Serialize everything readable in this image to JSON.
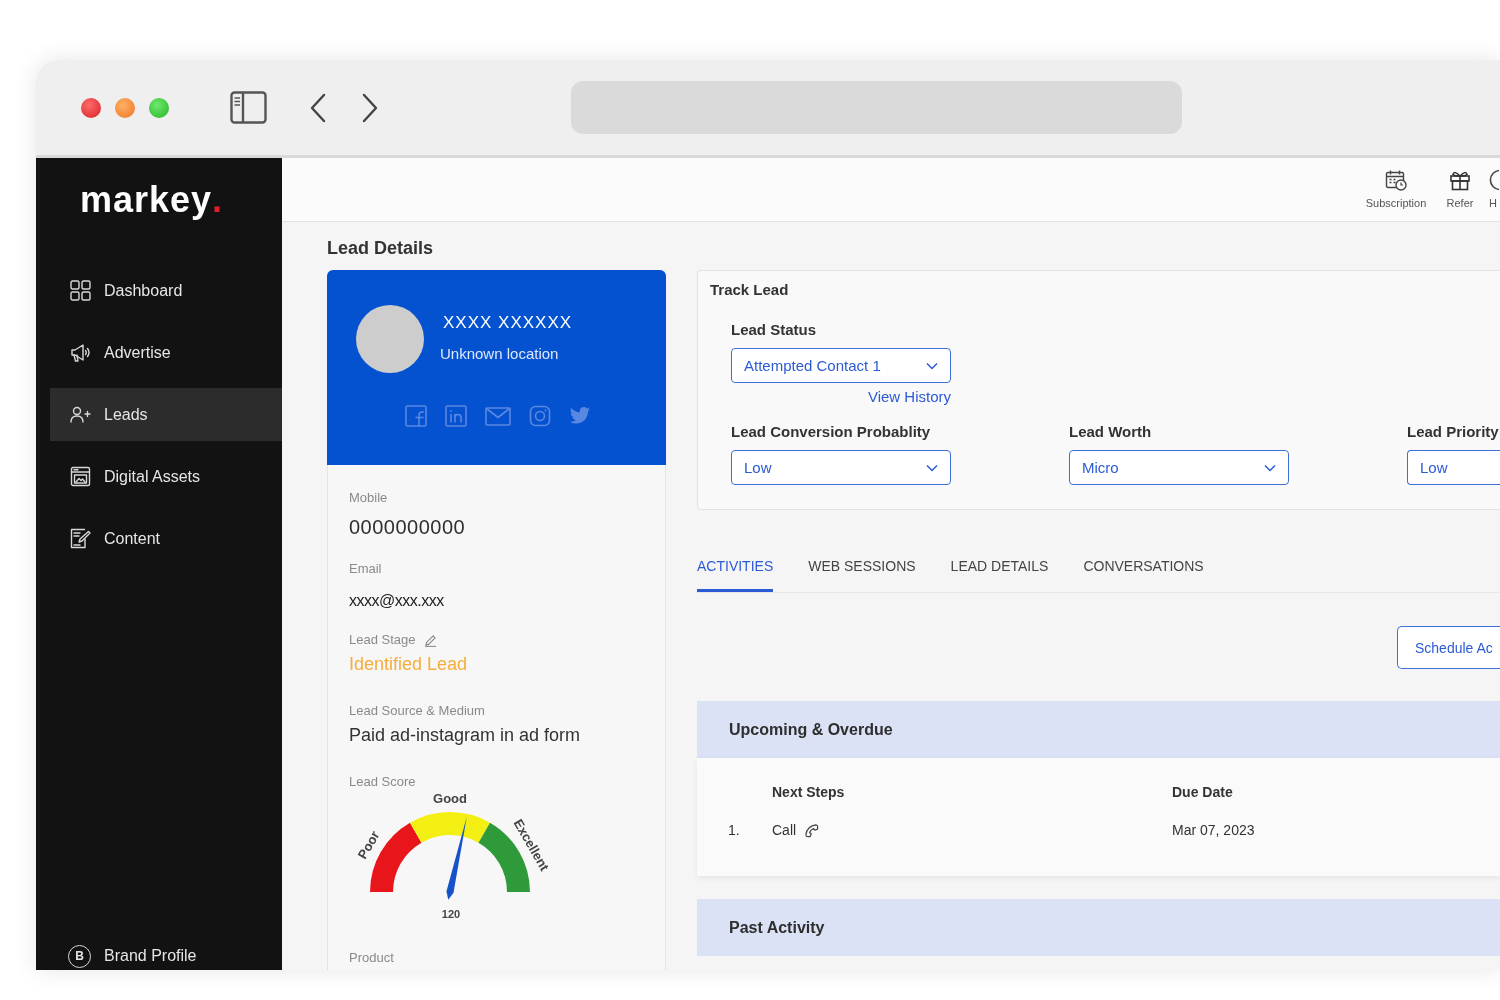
{
  "logo": {
    "name": "markey",
    "mark": "."
  },
  "sidebar": {
    "items": [
      {
        "label": "Dashboard",
        "selected": false
      },
      {
        "label": "Advertise",
        "selected": false
      },
      {
        "label": "Leads",
        "selected": true
      },
      {
        "label": "Digital Assets",
        "selected": false
      },
      {
        "label": "Content",
        "selected": false
      }
    ],
    "footer_item": {
      "badge": "B",
      "label": "Brand Profile"
    }
  },
  "top_bar": {
    "actions": [
      {
        "label": "Subscription"
      },
      {
        "label": "Refer"
      },
      {
        "label": "H"
      }
    ]
  },
  "page_title": "Lead Details",
  "profile": {
    "name": "XXXX XXXXXX",
    "location": "Unknown location"
  },
  "details": [
    {
      "kind": "phone",
      "label": "Mobile",
      "value": "0000000000",
      "editable": false
    },
    {
      "kind": "email",
      "label": "Email",
      "value": "xxxx@xxx.xxx",
      "editable": false
    },
    {
      "kind": "stage",
      "label": "Lead Stage",
      "value": "Identified Lead",
      "editable": true
    },
    {
      "kind": "source",
      "label": "Lead Source & Medium",
      "value": "Paid ad-instagram in ad form",
      "editable": false
    }
  ],
  "lead_score": {
    "label": "Lead Score",
    "bands": [
      {
        "label": "Poor",
        "color": "#e8161b"
      },
      {
        "label": "Good",
        "color": "#f4ef12"
      },
      {
        "label": "Excellent",
        "color": "#2f9a3a"
      }
    ],
    "value": "120",
    "level": 0.57
  },
  "product": {
    "label": "Product"
  },
  "track_lead": {
    "title": "Track Lead",
    "status": {
      "label": "Lead Status",
      "value": "Attempted Contact 1",
      "link": "View History"
    },
    "fields": [
      {
        "label": "Lead Conversion Probablity",
        "value": "Low"
      },
      {
        "label": "Lead Worth",
        "value": "Micro"
      },
      {
        "label": "Lead Priority",
        "value": "Low"
      }
    ]
  },
  "tabs": [
    {
      "label": "ACTIVITIES",
      "selected": true
    },
    {
      "label": "WEB SESSIONS",
      "selected": false
    },
    {
      "label": "LEAD DETAILS",
      "selected": false
    },
    {
      "label": "CONVERSATIONS",
      "selected": false
    }
  ],
  "schedule_button": "Schedule Ac",
  "upcoming": {
    "title": "Upcoming & Overdue",
    "columns": [
      "Next Steps",
      "Due Date"
    ],
    "rows": [
      {
        "number": "1.",
        "step": "Call",
        "due": "Mar 07, 2023"
      }
    ]
  },
  "past_activity": {
    "title": "Past Activity"
  }
}
